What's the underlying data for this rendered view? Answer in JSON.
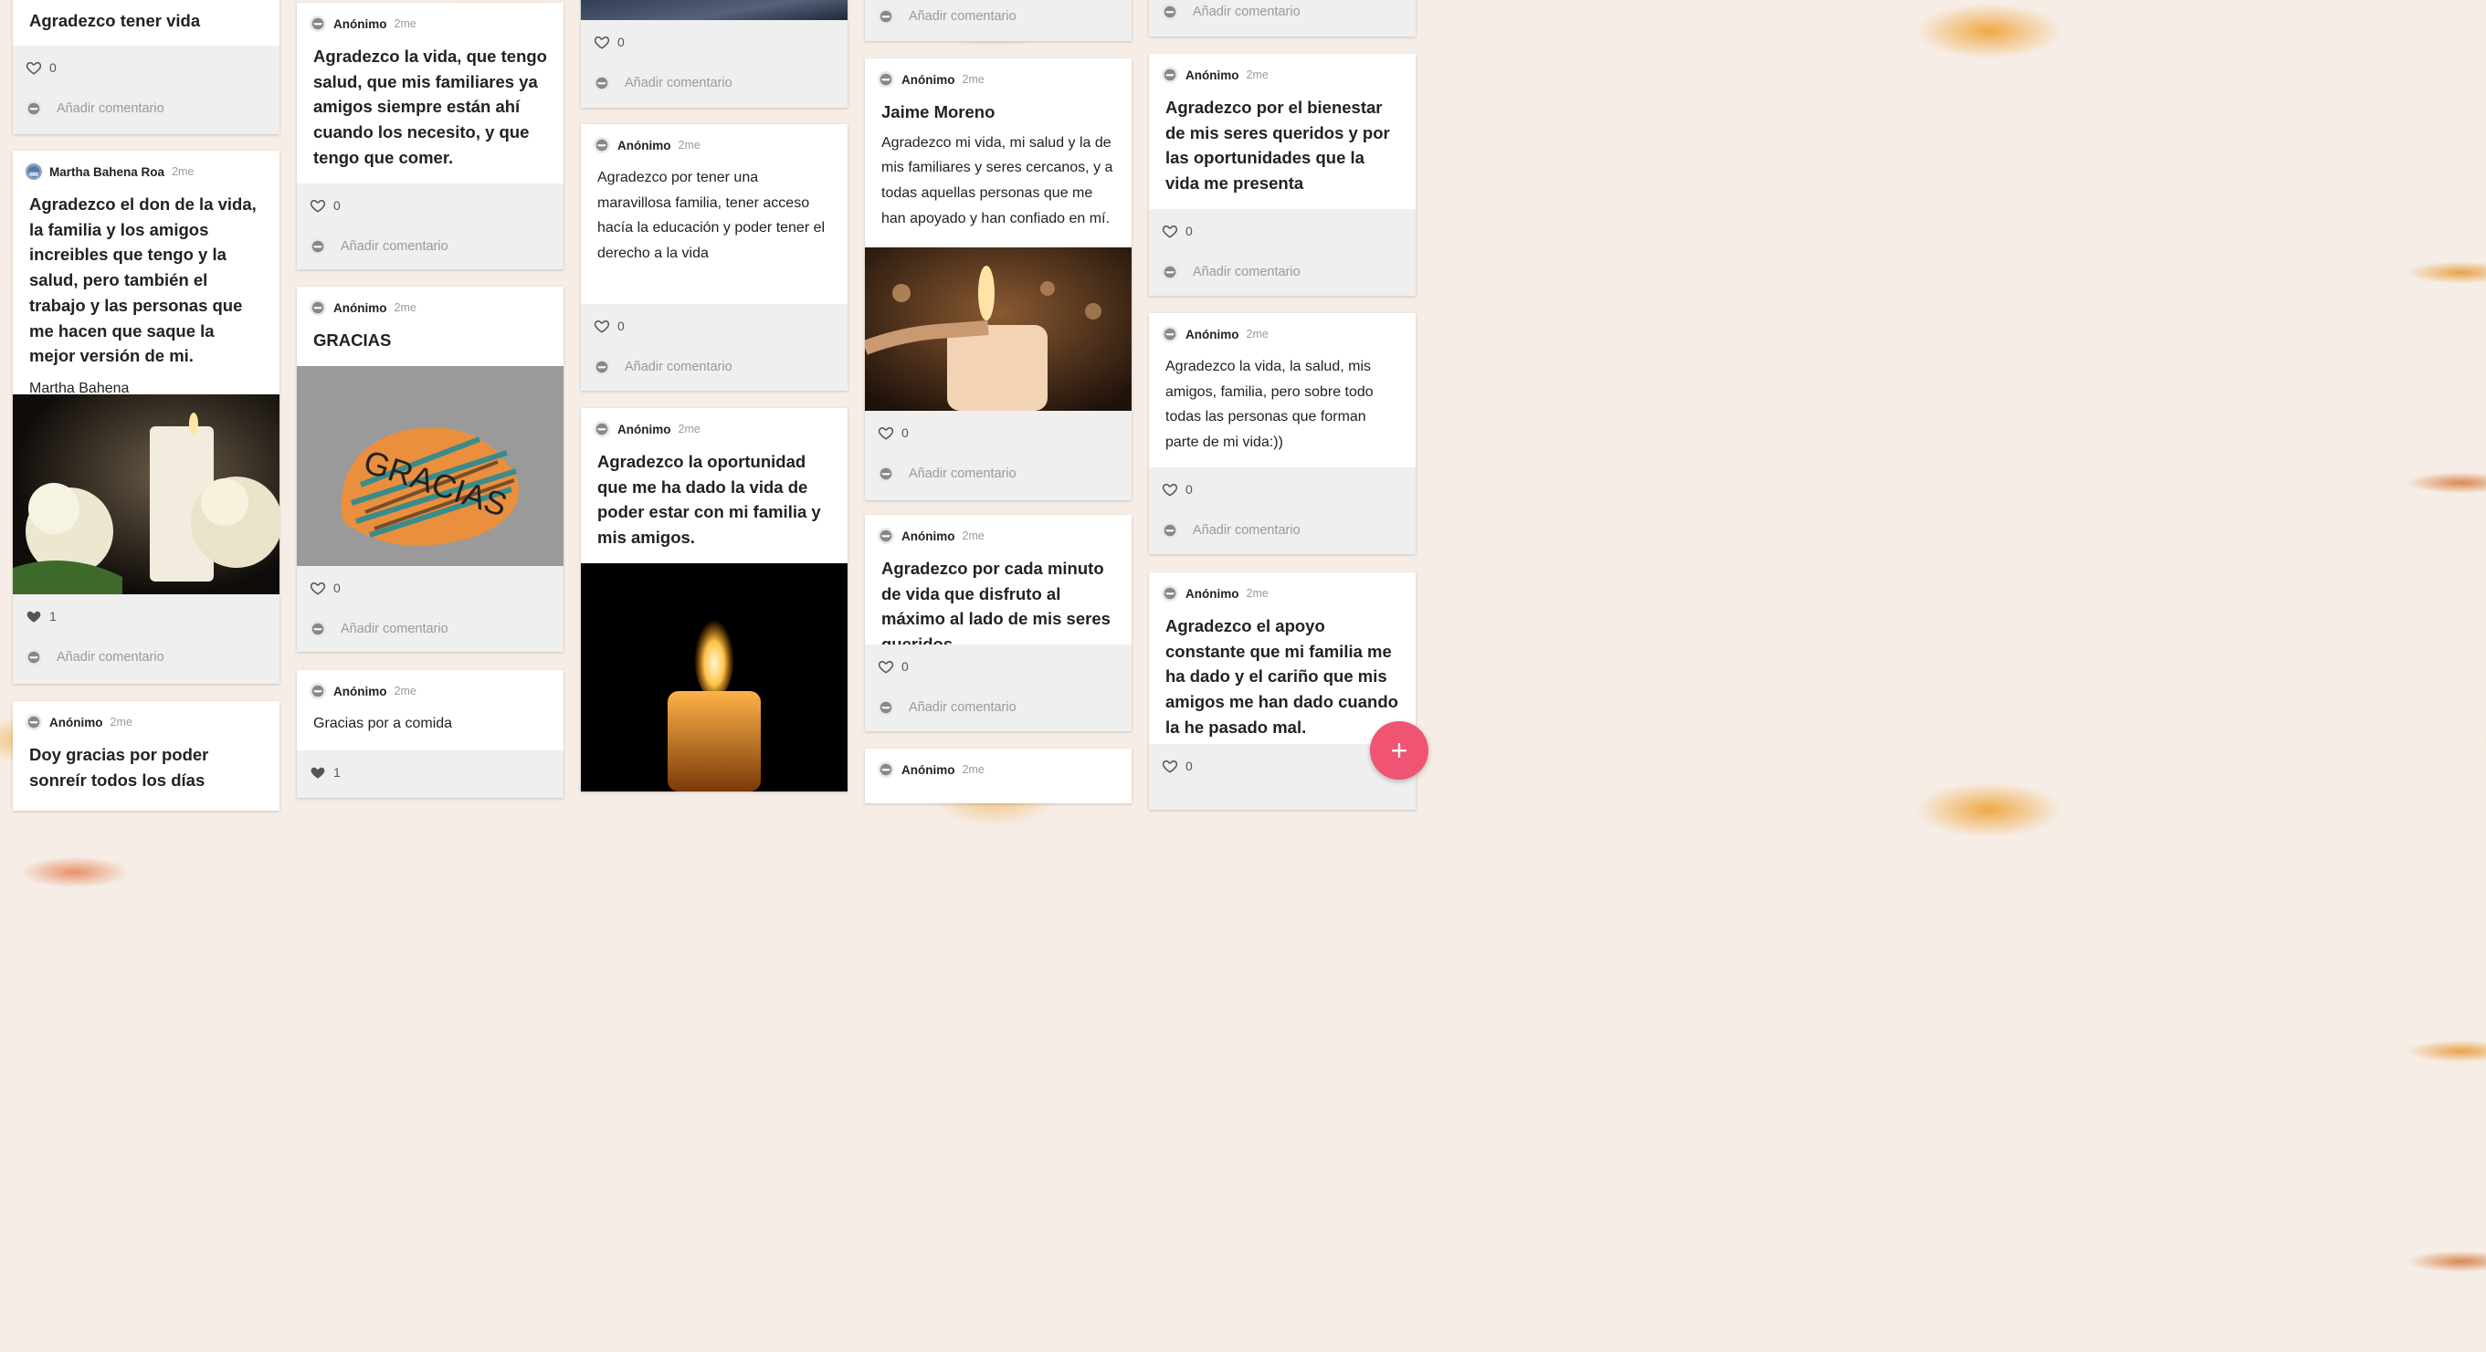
{
  "ui": {
    "anon_name": "Anónimo",
    "time": "2me",
    "add_comment": "Añadir comentario"
  },
  "colors": {
    "fab": "#ef5573",
    "card_footer": "#efefef",
    "background": "#f6ede6"
  },
  "cards": [
    {
      "title": "Agradezco tener vida",
      "likes": "0",
      "liked": false
    },
    {
      "author": "Martha Bahena Roa",
      "title": "Agradezco el don de la vida, la familia y los amigos increibles que tengo y la salud, pero también el trabajo y las personas que me hacen que saque la mejor versión de mi.",
      "body": "Martha Bahena",
      "image": "white roses and candle",
      "likes": "1",
      "liked": true
    },
    {
      "title": "Doy gracias por poder sonreír todos los días"
    },
    {
      "title": "Agradezco la vida, que tengo salud, que mis familiares ya amigos siempre están ahí cuando los necesito, y que tengo que comer.",
      "likes": "0",
      "liked": false
    },
    {
      "title": "GRACIAS",
      "image": "stone painted with GRACIAS",
      "image_text": "GRACIAS",
      "likes": "0",
      "liked": false
    },
    {
      "body": "Gracias por a comida",
      "likes": "1",
      "liked": true
    },
    {
      "image": "image",
      "likes": "0",
      "liked": false
    },
    {
      "body": "Agradezco por tener una maravillosa familia, tener acceso hacía la educación y poder tener el derecho a la vida",
      "likes": "0",
      "liked": false
    },
    {
      "title": "Agradezco la oportunidad que me ha dado la vida de poder estar con mi familia y mis amigos.",
      "image": "lit candle on black background"
    },
    {
      "likes": "",
      "liked": false
    },
    {
      "title": "Jaime Moreno",
      "body": "Agradezco mi vida, mi salud y la de mis familiares y seres cercanos, y a todas aquellas personas que me han apoyado y han confiado en mí.",
      "image": "hand lighting candle with match",
      "likes": "0",
      "liked": false
    },
    {
      "title": "Agradezco por cada minuto de vida que disfruto al máximo al lado de mis seres queridos",
      "likes": "0",
      "liked": false
    },
    {
      "title": ""
    },
    {
      "likes": "",
      "liked": false
    },
    {
      "title": "Agradezco por el bienestar de mis seres queridos y por las oportunidades que la vida me presenta",
      "likes": "0",
      "liked": false
    },
    {
      "body": "Agradezco la vida, la salud, mis amigos, familia, pero sobre todo todas las personas que forman parte de mi vida:))",
      "likes": "0",
      "liked": false
    },
    {
      "title": "Agradezco el apoyo constante que mi familia me ha dado y el cariño que mis amigos me han dado cuando la he pasado mal.",
      "likes": "0",
      "liked": false
    }
  ],
  "fab": {
    "label": "+"
  }
}
